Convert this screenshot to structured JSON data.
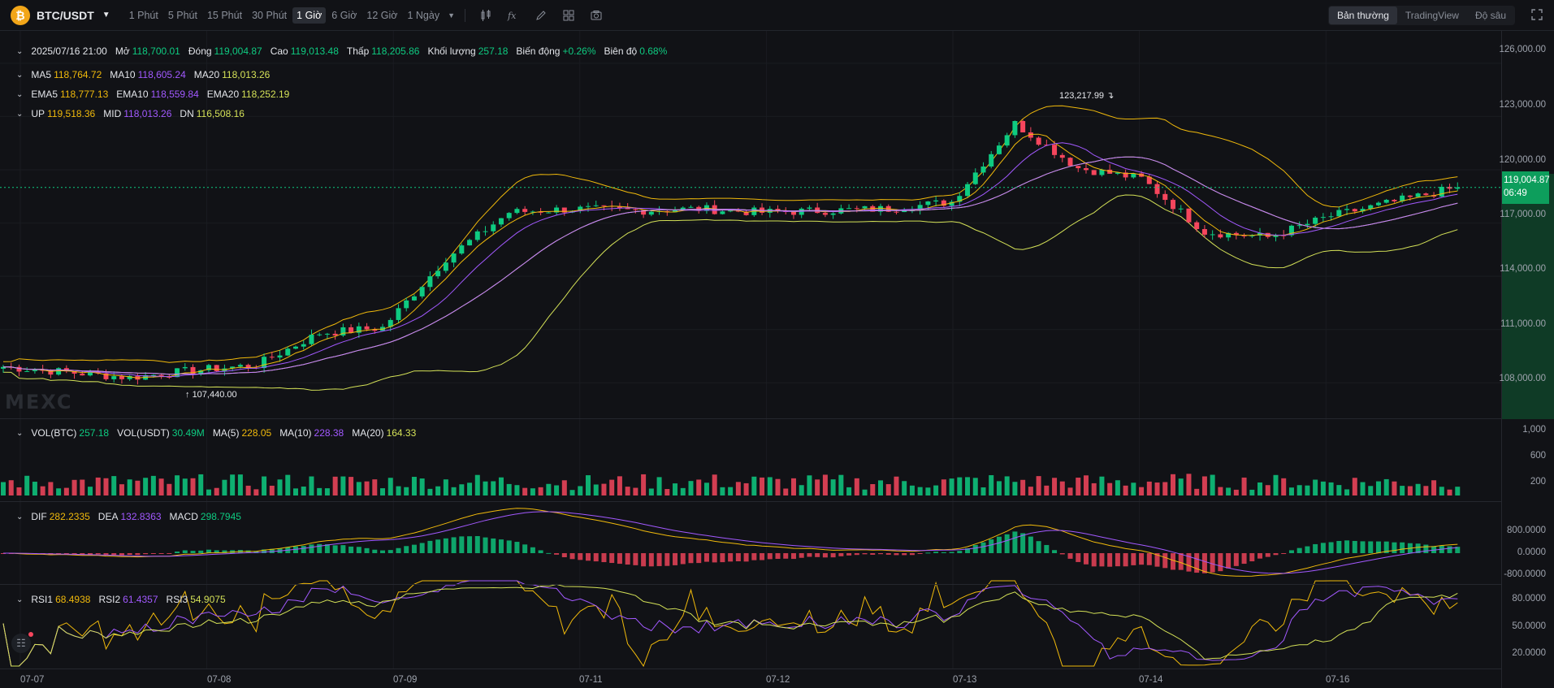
{
  "symbol": "BTC/USDT",
  "logo_glyph": "₿",
  "intervals": [
    "1 Phút",
    "5 Phút",
    "15 Phút",
    "30 Phút",
    "1 Giờ",
    "6 Giờ",
    "12 Giờ",
    "1 Ngày"
  ],
  "active_interval": "1 Giờ",
  "view_modes": [
    "Bản thường",
    "TradingView",
    "Độ sâu"
  ],
  "active_view": "Bản thường",
  "ohlc": {
    "date": "2025/07/16 21:00",
    "open_label": "Mở",
    "open": "118,700.01",
    "close_label": "Đóng",
    "close": "119,004.87",
    "high_label": "Cao",
    "high": "119,013.48",
    "low_label": "Thấp",
    "low": "118,205.86",
    "volume_label": "Khối lượng",
    "volume": "257.18",
    "change_label": "Biến động",
    "change": "+0.26%",
    "amplitude_label": "Biên độ",
    "amplitude": "0.68%"
  },
  "ma": {
    "ma5_label": "MA5",
    "ma5": "118,764.72",
    "ma10_label": "MA10",
    "ma10": "118,605.24",
    "ma20_label": "MA20",
    "ma20": "118,013.26"
  },
  "ema": {
    "ema5_label": "EMA5",
    "ema5": "118,777.13",
    "ema10_label": "EMA10",
    "ema10": "118,559.84",
    "ema20_label": "EMA20",
    "ema20": "118,252.19"
  },
  "boll": {
    "up_label": "UP",
    "up": "119,518.36",
    "mid_label": "MID",
    "mid": "118,013.26",
    "dn_label": "DN",
    "dn": "116,508.16"
  },
  "vol": {
    "btc_label": "VOL(BTC)",
    "btc": "257.18",
    "usdt_label": "VOL(USDT)",
    "usdt": "30.49M",
    "ma5_label": "MA(5)",
    "ma5": "228.05",
    "ma10_label": "MA(10)",
    "ma10": "228.38",
    "ma20_label": "MA(20)",
    "ma20": "164.33"
  },
  "macd": {
    "dif_label": "DIF",
    "dif": "282.2335",
    "dea_label": "DEA",
    "dea": "132.8363",
    "macd_label": "MACD",
    "macd": "298.7945"
  },
  "rsi": {
    "rsi1_label": "RSI1",
    "rsi1": "68.4938",
    "rsi2_label": "RSI2",
    "rsi2": "61.4357",
    "rsi3_label": "RSI3",
    "rsi3": "54.9075"
  },
  "price_ticks": [
    "126,000.00",
    "123,000.00",
    "120,000.00",
    "117,000.00",
    "114,000.00",
    "111,000.00",
    "108,000.00"
  ],
  "volume_ticks": [
    "1,000",
    "600",
    "200"
  ],
  "macd_ticks": [
    "800.0000",
    "0.0000",
    "-800.0000"
  ],
  "rsi_ticks": [
    "80.0000",
    "50.0000",
    "20.0000"
  ],
  "x_labels": [
    "07-07",
    "07-08",
    "07-09",
    "07-11",
    "07-12",
    "07-13",
    "07-14",
    "07-16"
  ],
  "last_price": "119,004.87",
  "countdown": "06:49",
  "high_annotation": "123,217.99",
  "low_annotation": "107,440.00",
  "watermark": "MEXC",
  "colors": {
    "up": "#0ecb81",
    "down": "#f6465d",
    "ma5": "#f0b90b",
    "ma10": "#a259ff",
    "ma20": "#d4e157",
    "accent": "#f2a619"
  },
  "chart_data": {
    "type": "candlestick",
    "interval": "1 Giờ",
    "y_unit": "USDT",
    "ylim": [
      106000,
      127000
    ],
    "x": [
      "07-07",
      "07-08",
      "07-09",
      "07-11",
      "07-12",
      "07-13",
      "07-14",
      "07-16"
    ],
    "close_approx": [
      108900,
      108600,
      108300,
      108700,
      109000,
      110800,
      111100,
      115000,
      117600,
      117800,
      117700,
      117800,
      117600,
      117700,
      117800,
      118200,
      122600,
      120100,
      119500,
      116500,
      116200,
      117400,
      118200,
      119004.87
    ],
    "indicators": [
      "MA5",
      "MA10",
      "MA20",
      "EMA5",
      "EMA10",
      "EMA20",
      "BOLL"
    ],
    "subpanes": [
      "VOL",
      "MACD",
      "RSI"
    ]
  }
}
